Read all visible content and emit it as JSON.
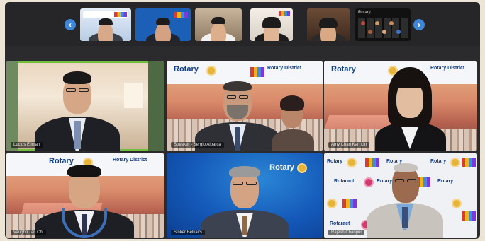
{
  "strip": {
    "prev_icon": "chevron-left-icon",
    "next_icon": "chevron-right-icon",
    "thumbnails": [
      {
        "id": "thumb-1"
      },
      {
        "id": "thumb-2"
      },
      {
        "id": "thumb-3"
      },
      {
        "id": "thumb-4"
      },
      {
        "id": "thumb-5"
      },
      {
        "id": "thumb-6",
        "label": "Rotary"
      }
    ]
  },
  "brand": {
    "rotary": "Rotary",
    "rotary_district": "Rotary District",
    "rotaract": "Rotaract",
    "colors": {
      "rotary_blue": "#12408a",
      "rotary_gold": "#e7b43a",
      "active_border": "#6fbf3c"
    }
  },
  "tiles": [
    {
      "name": "Lucius Ellman",
      "active": true
    },
    {
      "name": "Speaker - Sergio Albarca"
    },
    {
      "name": "Amy Chan Kan Lin"
    },
    {
      "name": "Vaughn Tan Chi"
    },
    {
      "name": "Sinker Belkairs"
    },
    {
      "name": "Rajesh Chanpur"
    }
  ]
}
